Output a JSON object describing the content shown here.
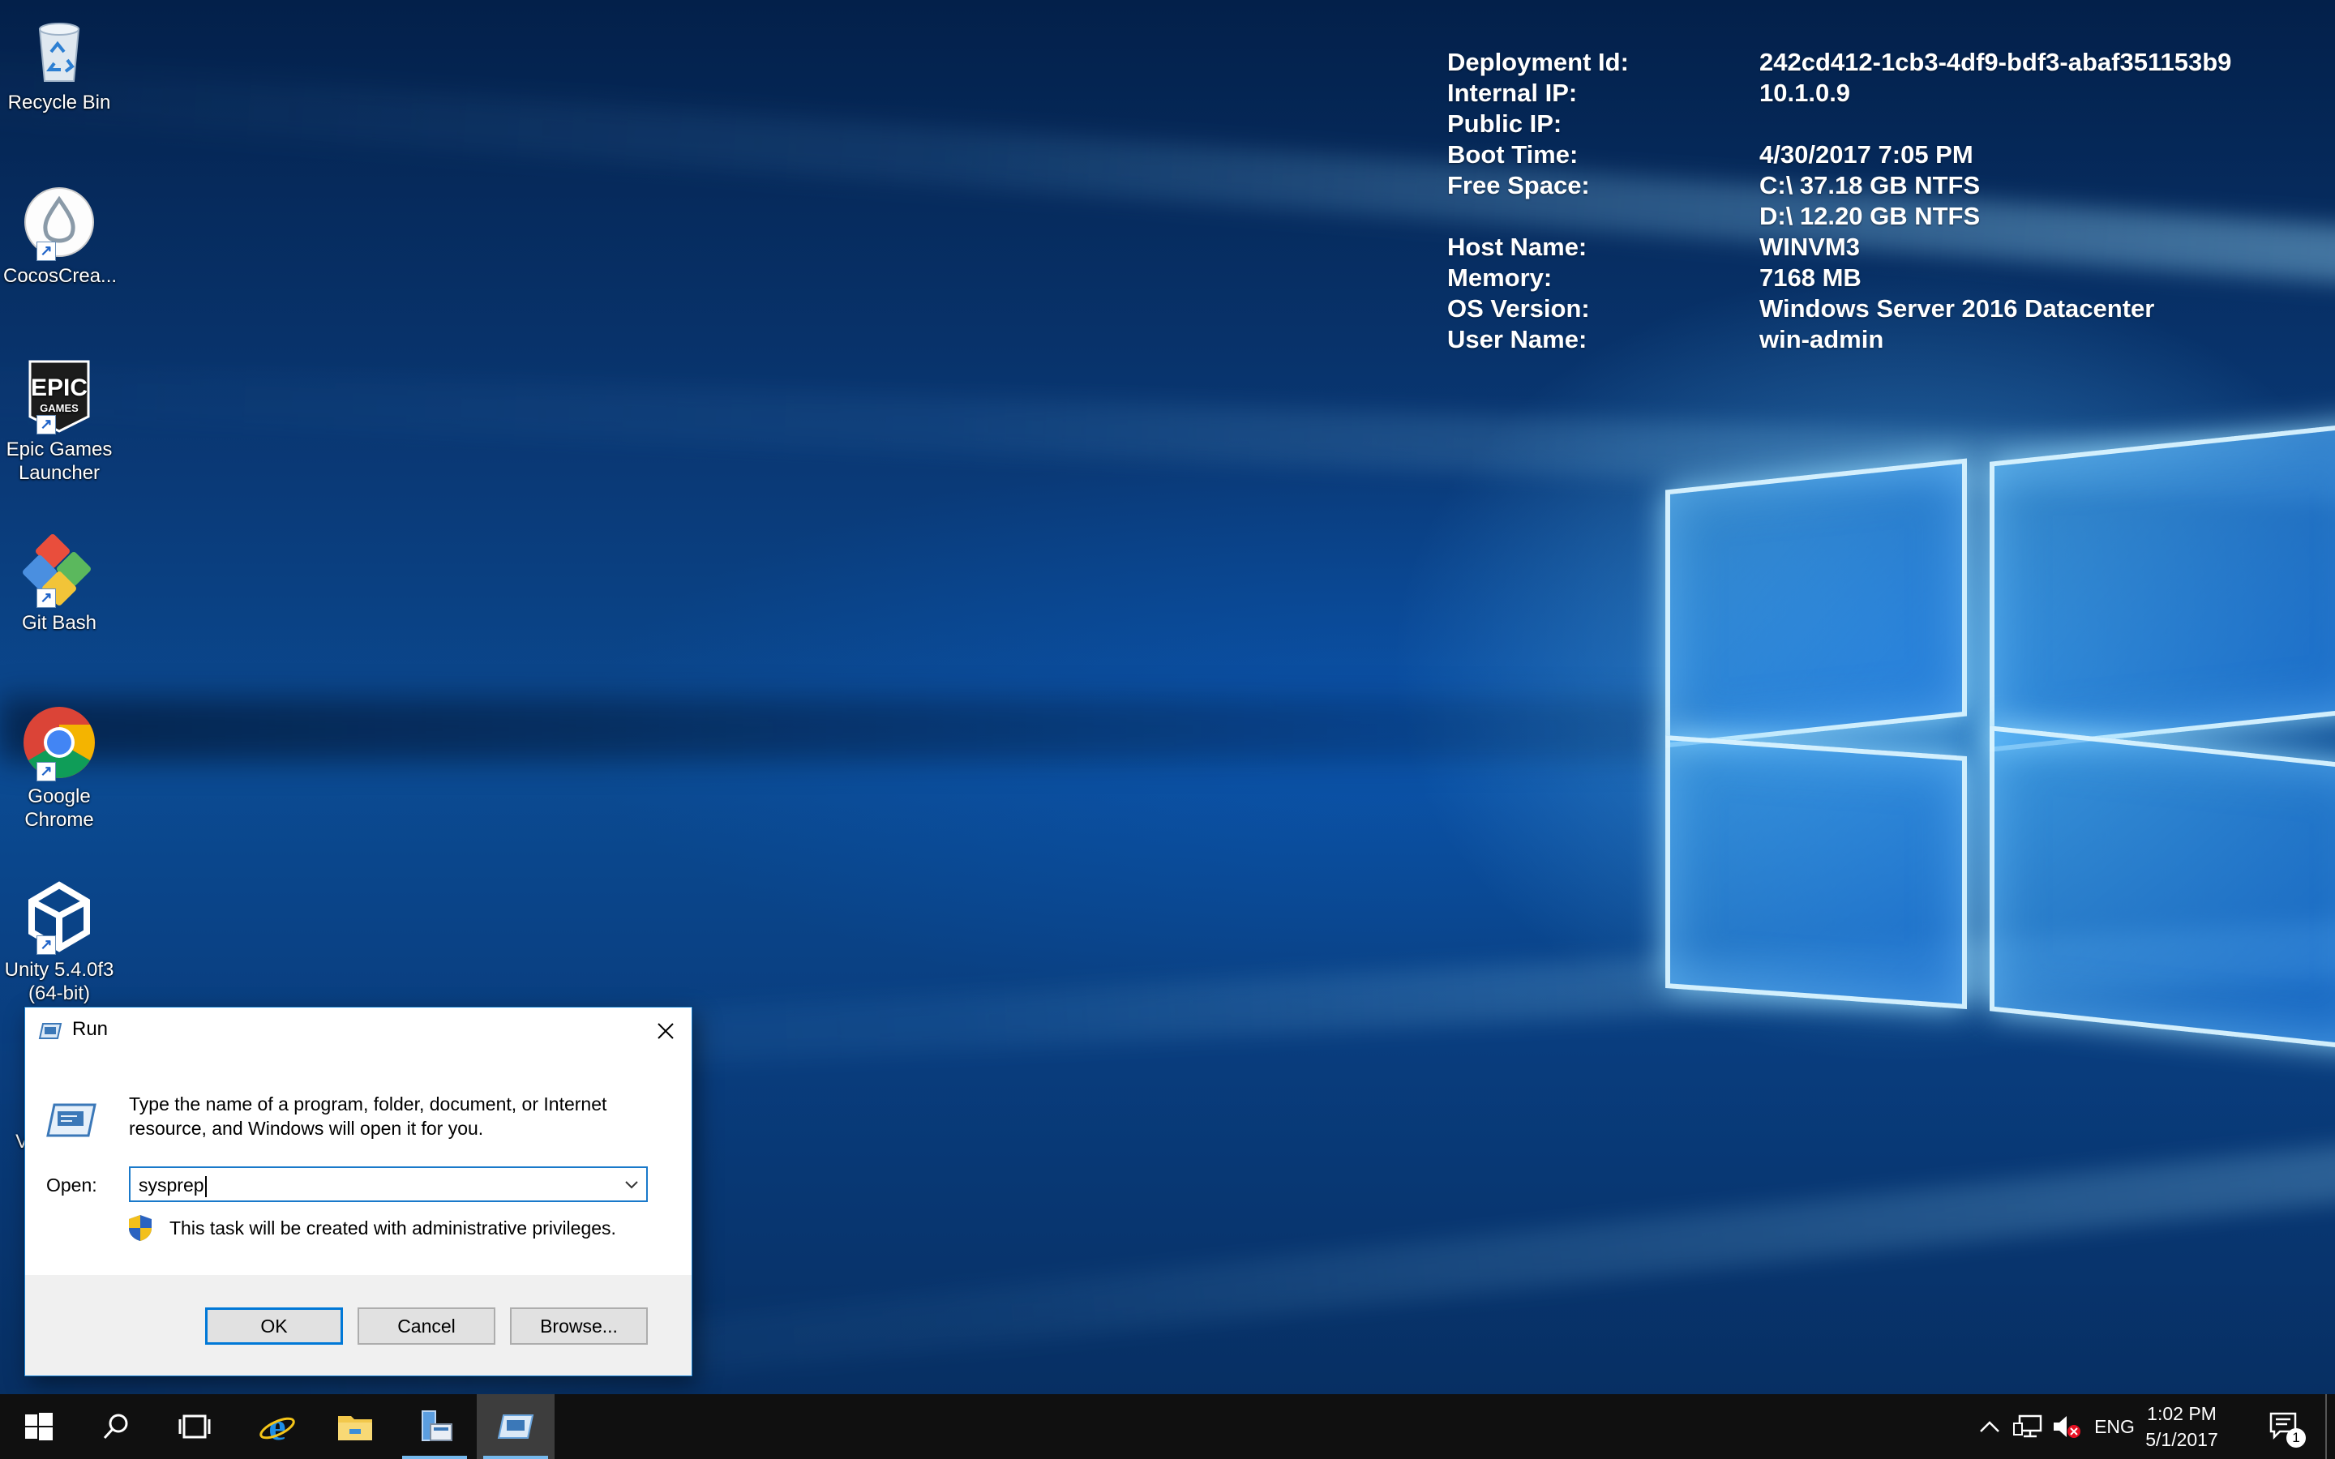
{
  "desktop": {
    "icons": [
      {
        "label": "Recycle Bin",
        "icon": "recycle-bin-icon"
      },
      {
        "label": "CocosCrea...",
        "icon": "cocos-creator-icon"
      },
      {
        "label": "Epic Games Launcher",
        "icon": "epic-games-icon"
      },
      {
        "label": "Git Bash",
        "icon": "git-bash-icon"
      },
      {
        "label": "Google Chrome",
        "icon": "chrome-icon"
      },
      {
        "label": "Unity 5.4.0f3 (64-bit)",
        "icon": "unity-icon"
      },
      {
        "label": "Vi",
        "icon": "partial-hidden-icon"
      }
    ]
  },
  "bginfo": [
    {
      "key": "Deployment Id:",
      "value": "242cd412-1cb3-4df9-bdf3-abaf351153b9"
    },
    {
      "key": "Internal IP:",
      "value": "10.1.0.9"
    },
    {
      "key": "Public IP:",
      "value": ""
    },
    {
      "key": "Boot Time:",
      "value": "4/30/2017 7:05 PM"
    },
    {
      "key": "Free Space:",
      "value": "C:\\ 37.18 GB NTFS"
    },
    {
      "key": "",
      "value": "D:\\ 12.20 GB NTFS"
    },
    {
      "key": "Host Name:",
      "value": "WINVM3"
    },
    {
      "key": "Memory:",
      "value": "7168 MB"
    },
    {
      "key": "OS Version:",
      "value": "Windows Server 2016 Datacenter"
    },
    {
      "key": "User Name:",
      "value": "win-admin"
    }
  ],
  "run_dialog": {
    "title": "Run",
    "description": "Type the name of a program, folder, document, or Internet resource, and Windows will open it for you.",
    "open_label": "Open:",
    "open_value": "sysprep",
    "admin_note": "This task will be created with administrative privileges.",
    "ok_label": "OK",
    "cancel_label": "Cancel",
    "browse_label": "Browse..."
  },
  "taskbar": {
    "language": "ENG",
    "time": "1:02 PM",
    "date": "5/1/2017",
    "notification_count": "1",
    "accent_color": "#76b9ed"
  }
}
